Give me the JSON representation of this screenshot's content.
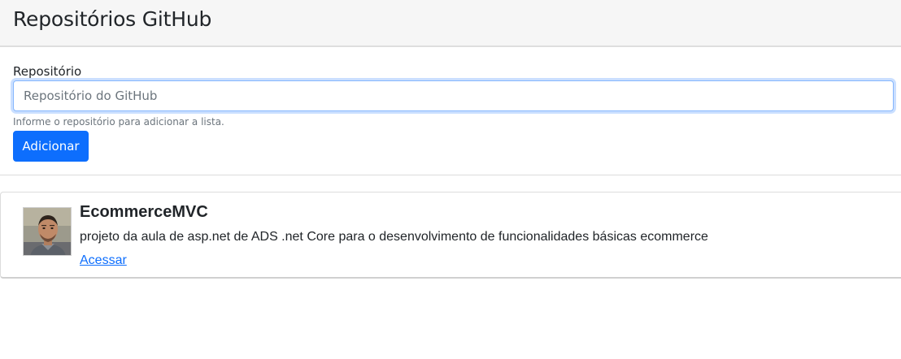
{
  "header": {
    "title": "Repositórios GitHub"
  },
  "form": {
    "label": "Repositório",
    "input_value": "",
    "input_placeholder": "Repositório do GitHub",
    "help_text": "Informe o repositório para adicionar a lista.",
    "submit_label": "Adicionar"
  },
  "repositories": [
    {
      "name": "EcommerceMVC",
      "description": "projeto da aula de asp.net de ADS .net Core para o desenvolvimento de funcionalidades básicas ecommerce",
      "link_label": "Acessar",
      "avatar_icon": "user-avatar-photo"
    }
  ],
  "colors": {
    "primary": "#0d6efd",
    "header_bg": "#f6f6f6",
    "muted_text": "#6c757d",
    "focus_border": "#86b7fe"
  }
}
